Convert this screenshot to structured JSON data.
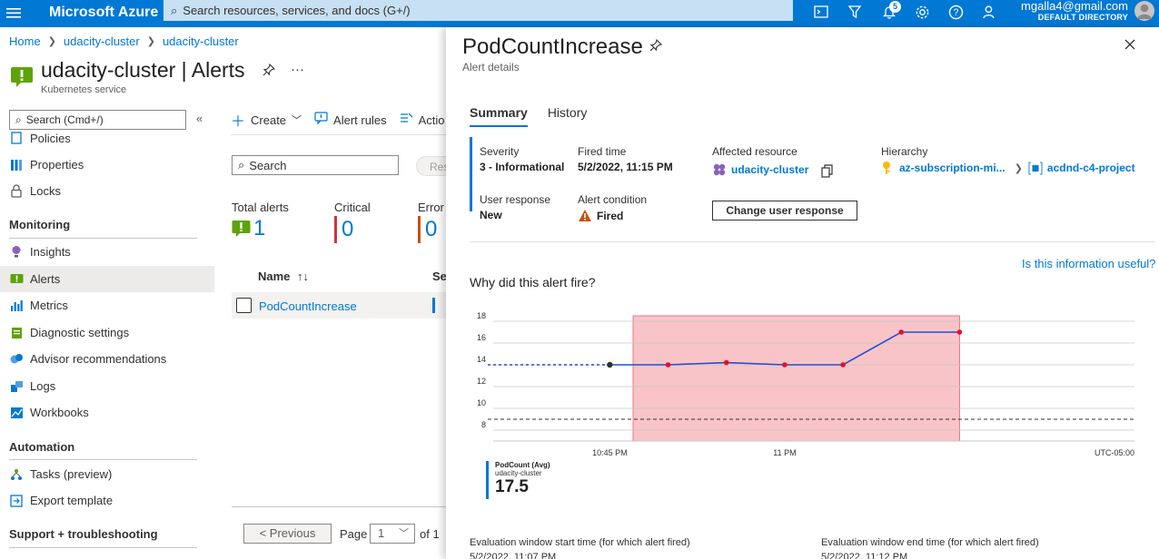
{
  "topbar": {
    "brand": "Microsoft Azure",
    "search_placeholder": "Search resources, services, and docs (G+/)",
    "notifications_count": "5",
    "account_email": "mgalla4@gmail.com",
    "account_directory": "DEFAULT DIRECTORY"
  },
  "breadcrumb": [
    "Home",
    "udacity-cluster",
    "udacity-cluster"
  ],
  "resource": {
    "title": "udacity-cluster | Alerts",
    "subtitle": "Kubernetes service"
  },
  "sidebar": {
    "search_placeholder": "Search (Cmd+/)",
    "items": [
      {
        "label": "Policies",
        "icon": "policies-icon"
      },
      {
        "label": "Properties",
        "icon": "properties-icon"
      },
      {
        "label": "Locks",
        "icon": "lock-icon"
      }
    ],
    "monitoring_header": "Monitoring",
    "monitoring_items": [
      {
        "label": "Insights",
        "icon": "insights-icon"
      },
      {
        "label": "Alerts",
        "icon": "alerts-icon",
        "active": true
      },
      {
        "label": "Metrics",
        "icon": "metrics-icon"
      },
      {
        "label": "Diagnostic settings",
        "icon": "diagnostic-icon"
      },
      {
        "label": "Advisor recommendations",
        "icon": "advisor-icon"
      },
      {
        "label": "Logs",
        "icon": "logs-icon"
      },
      {
        "label": "Workbooks",
        "icon": "workbooks-icon"
      }
    ],
    "automation_header": "Automation",
    "automation_items": [
      {
        "label": "Tasks (preview)",
        "icon": "tasks-icon"
      },
      {
        "label": "Export template",
        "icon": "export-icon"
      }
    ],
    "support_header": "Support + troubleshooting"
  },
  "commands": {
    "create": "Create",
    "alert_rules": "Alert rules",
    "action": "Actio"
  },
  "alerts_list": {
    "search_placeholder": "Search",
    "reset_label": "Res",
    "stats": [
      {
        "label": "Total alerts",
        "value": "1"
      },
      {
        "label": "Critical",
        "value": "0",
        "color": "#d13438"
      },
      {
        "label": "Error",
        "value": "0",
        "color": "#ca5010"
      }
    ],
    "column_name": "Name",
    "column_severity": "Sev",
    "rows": [
      {
        "name": "PodCountIncrease"
      }
    ],
    "previous_label": "< Previous",
    "page_label": "Page",
    "page_value": "1",
    "of_label": "of 1"
  },
  "blade": {
    "title": "PodCountIncrease",
    "subtitle": "Alert details",
    "tabs": [
      "Summary",
      "History"
    ],
    "summary": {
      "severity_label": "Severity",
      "severity_value": "3 - Informational",
      "fired_time_label": "Fired time",
      "fired_time_value": "5/2/2022, 11:15 PM",
      "affected_label": "Affected resource",
      "affected_value": "udacity-cluster",
      "hierarchy_label": "Hierarchy",
      "hierarchy_sub": "az-subscription-mi...",
      "hierarchy_rg": "acdnd-c4-project",
      "user_response_label": "User response",
      "user_response_value": "New",
      "alert_condition_label": "Alert condition",
      "alert_condition_value": "Fired",
      "change_button": "Change user response"
    },
    "useful_link": "Is this information useful?",
    "why_heading": "Why did this alert fire?",
    "legend": {
      "metric": "PodCount (Avg)",
      "resource": "udacity-cluster",
      "value": "17.5"
    },
    "eval_start_label": "Evaluation window start time (for which alert fired)",
    "eval_start_value": "5/2/2022, 11:07 PM",
    "eval_end_label": "Evaluation window end time (for which alert fired)",
    "eval_end_value": "5/2/2022, 11:12 PM"
  },
  "chart_data": {
    "type": "line",
    "series": [
      {
        "name": "PodCount (Avg)",
        "x": [
          "10:45 PM",
          "10:50 PM",
          "10:55 PM",
          "11:00 PM",
          "11:05 PM",
          "11:10 PM",
          "11:15 PM"
        ],
        "values": [
          14,
          14,
          14.2,
          14,
          14,
          17,
          17
        ]
      }
    ],
    "x_tick_labels": [
      "10:45 PM",
      "11 PM",
      "UTC-05:00"
    ],
    "y_ticks": [
      8,
      10,
      12,
      14,
      16,
      18
    ],
    "ylim": [
      7,
      18.5
    ],
    "threshold": 9,
    "fired_window": [
      "10:47 PM",
      "11:15 PM"
    ],
    "colors": {
      "line": "#1f4fd1",
      "point": "#e81123",
      "window": "#f8c4c8",
      "window_border": "#e8777f"
    }
  }
}
